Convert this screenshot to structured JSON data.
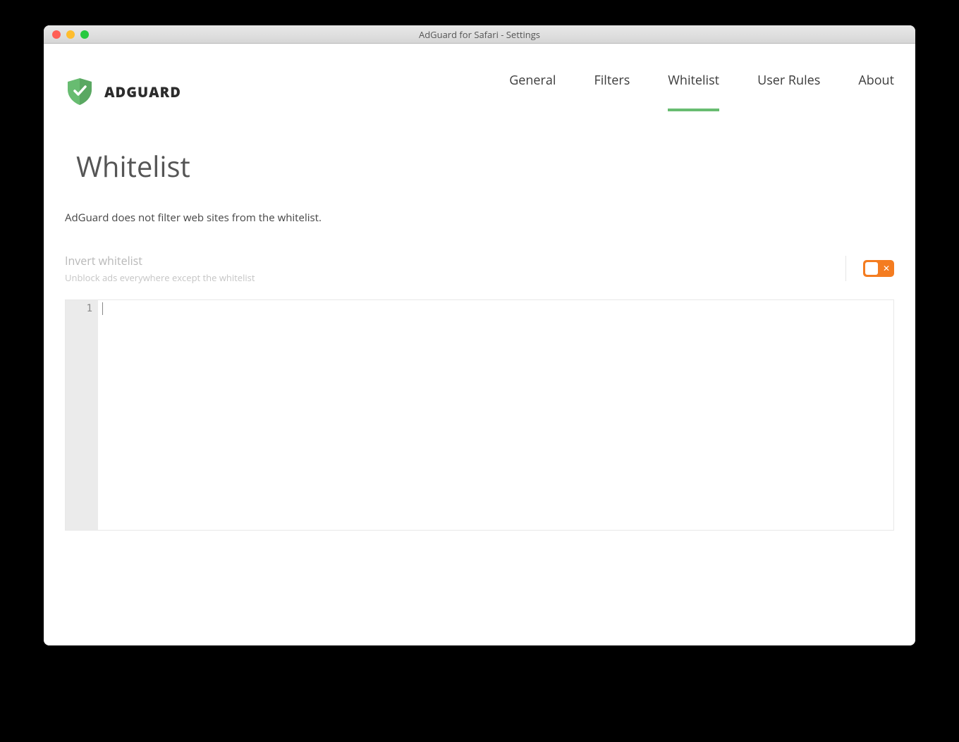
{
  "window": {
    "title": "AdGuard for Safari - Settings"
  },
  "logo": {
    "text": "ADGUARD"
  },
  "nav": {
    "items": [
      "General",
      "Filters",
      "Whitelist",
      "User Rules",
      "About"
    ],
    "active_index": 2
  },
  "page": {
    "title": "Whitelist",
    "description": "AdGuard does not filter web sites from the whitelist."
  },
  "invert_option": {
    "title": "Invert whitelist",
    "subtitle": "Unblock ads everywhere except the whitelist",
    "enabled": false
  },
  "editor": {
    "line_numbers": [
      "1"
    ],
    "content": ""
  },
  "colors": {
    "accent_green": "#68bc71",
    "accent_orange": "#f47c20"
  }
}
